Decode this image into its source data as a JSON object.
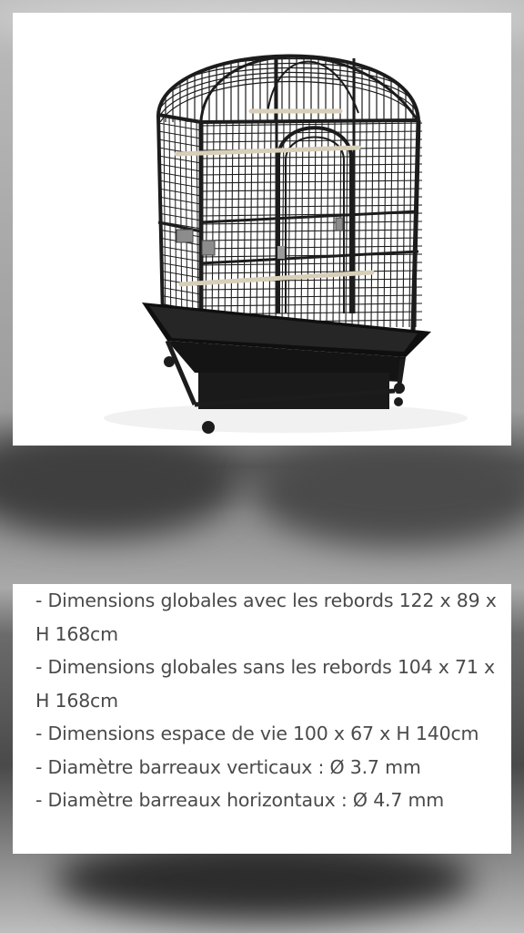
{
  "photo": {
    "subject_icon": "bird-cage-image"
  },
  "caption": {
    "lines": [
      "- Dimensions globales avec les rebords 122 x 89 x H 168cm",
      "- Dimensions globales sans les rebords 104 x 71 x H 168cm",
      "- Dimensions espace de vie 100 x 67 x H 140cm",
      "- Diamètre barreaux verticaux : Ø 3.7 mm",
      "- Diamètre barreaux horizontaux : Ø 4.7 mm"
    ]
  },
  "colors": {
    "cage": "#1c1c1c",
    "perch": "#d8cfb8",
    "text": "#4a4a4a",
    "card": "#ffffff"
  }
}
